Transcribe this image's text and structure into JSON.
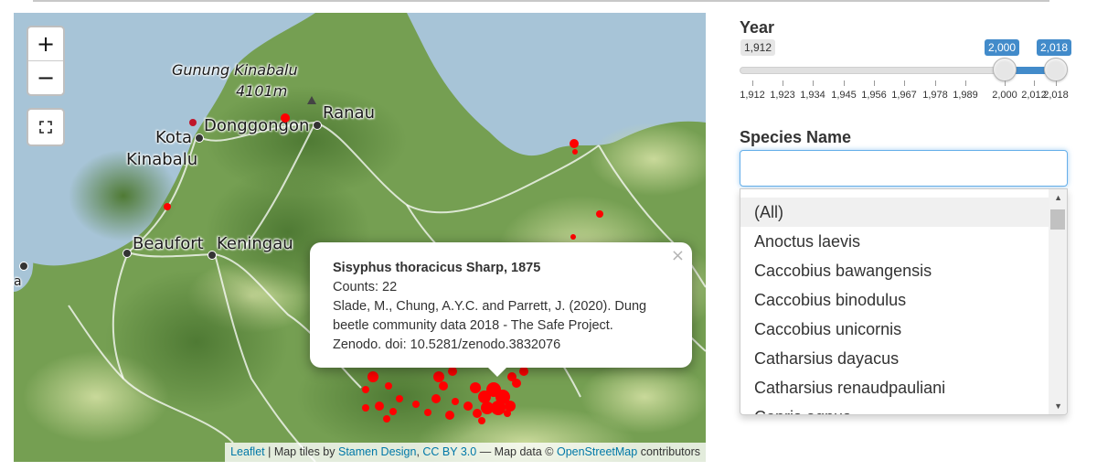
{
  "map": {
    "labels": {
      "mountain": "Gunung Kinabalu",
      "elevation": "4101m",
      "donggongon": "Donggongon",
      "ranau": "Ranau",
      "kota": "Kota",
      "kinabalu": "Kinabalu",
      "beaufort": "Beaufort",
      "keningau": "Keningau",
      "partial": "a"
    },
    "zoom_in": "+",
    "zoom_out": "−",
    "popup": {
      "title": "Sisyphus thoracicus Sharp, 1875",
      "counts": "Counts: 22",
      "citation": "Slade, M., Chung, A.Y.C. and Parrett, J. (2020). Dung beetle community data 2018 - The Safe Project. Zenodo. doi: 10.5281/zenodo.3832076",
      "close": "×"
    },
    "attribution": {
      "leaflet": "Leaflet",
      "sep1": " | Map tiles by ",
      "stamen": "Stamen Design",
      "comma": ", ",
      "license": "CC BY 3.0",
      "mapdata": " — Map data © ",
      "osm": "OpenStreetMap",
      "contrib": " contributors"
    },
    "marker_color": "#ff0000"
  },
  "sidebar": {
    "year": {
      "label": "Year",
      "min_label": "1,912",
      "from_label": "2,000",
      "to_label": "2,018",
      "range_min": 1912,
      "range_max": 2018,
      "selected_from": 2000,
      "selected_to": 2018,
      "ticks": [
        "1,912",
        "1,923",
        "1,934",
        "1,945",
        "1,956",
        "1,967",
        "1,978",
        "1,989",
        "2,000",
        "2,012",
        "2,018"
      ]
    },
    "species": {
      "label": "Species Name",
      "value": "",
      "options": [
        "(All)",
        "Anoctus laevis",
        "Caccobius bawangensis",
        "Caccobius binodulus",
        "Caccobius unicornis",
        "Catharsius dayacus",
        "Catharsius renaudpauliani",
        "Copris agnus"
      ]
    }
  }
}
